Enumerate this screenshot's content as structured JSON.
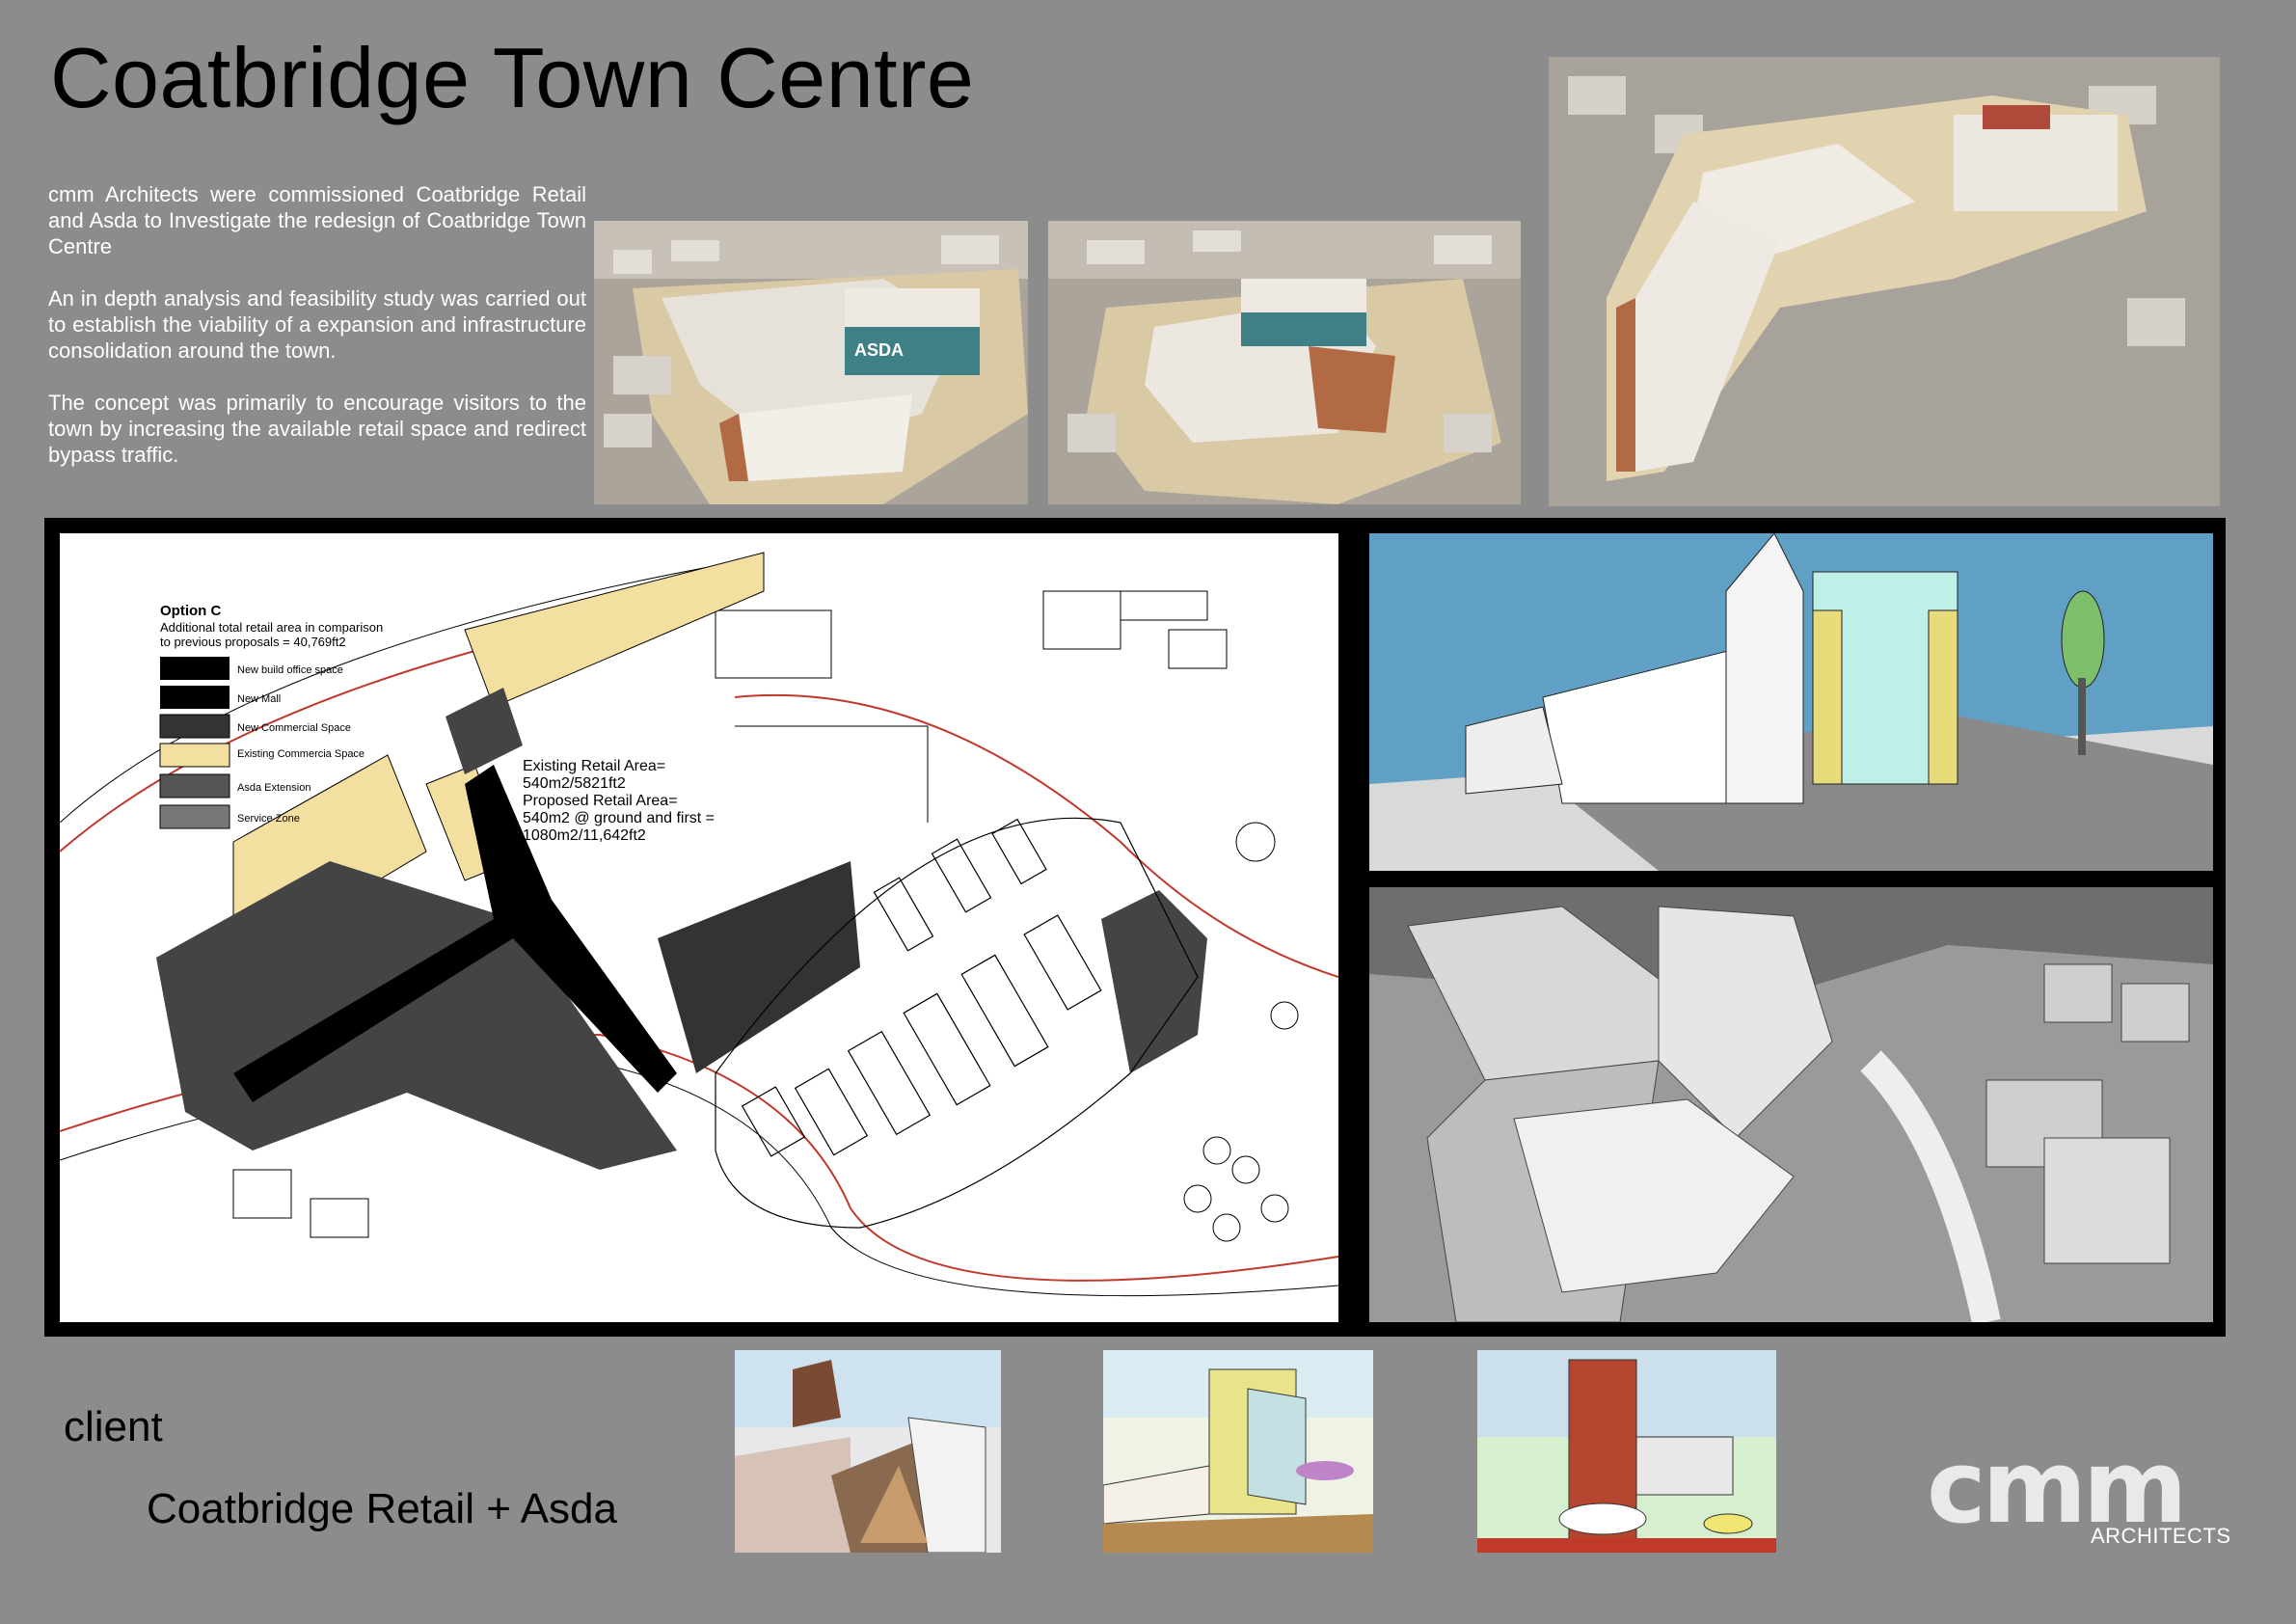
{
  "title": "Coatbridge Town Centre",
  "intro": {
    "p1": "cmm Architects were commissioned Coatbridge Retail and Asda to Investigate the redesign of Coatbridge Town Centre",
    "p2": "An in depth analysis and feasibility study was carried out to establish the viability of a expansion and infrastructure consolidation around the town.",
    "p3": "The  concept was primarily to encourage visitors to the town by increasing the available retail space and redirect bypass traffic."
  },
  "plan": {
    "option_title": "Option C",
    "option_desc_1": "Additional total retail area in comparison",
    "option_desc_2": "to previous proposals = 40,769ft2",
    "legend": [
      "New build office space",
      "New Mall",
      "New Commercial Space",
      "Existing Commercia Space",
      "Asda Extension",
      "Service Zone"
    ],
    "retail_1": "Existing Retail Area=",
    "retail_2": "540m2/5821ft2",
    "retail_3": "Proposed Retail Area=",
    "retail_4": "540m2 @ ground and first =",
    "retail_5": "1080m2/11,642ft2",
    "store_brand": "ASDA"
  },
  "client": {
    "label": "client",
    "name": "Coatbridge Retail + Asda"
  },
  "logo": {
    "name": "cmm",
    "sub": "ARCHITECTS"
  },
  "colors": {
    "background": "#8c8c8c",
    "existing_commercial": "#f3dfa0",
    "road_line": "#c0392b",
    "sky": "#5fa0c4"
  }
}
